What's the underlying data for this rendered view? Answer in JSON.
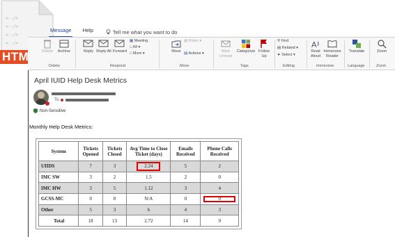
{
  "file_badge": "HTML",
  "ribbon": {
    "tabs": [
      "Message",
      "Help"
    ],
    "active_tab": "Message",
    "tell_me": "Tell me what you want to do",
    "buttons": {
      "delete": "Delete",
      "archive": "Archive",
      "reply": "Reply",
      "reply_all": "Reply All",
      "forward": "Forward",
      "meeting": "Meeting",
      "im": "IM",
      "more": "More",
      "move": "Move",
      "rules": "Rules",
      "actions": "Actions",
      "mark_unread": "Mark Unread",
      "categorize": "Categorize",
      "follow_up": "Follow Up",
      "find": "Find",
      "related": "Related",
      "select": "Select",
      "read_aloud": "Read Aloud",
      "immersive_reader": "Immersive Reader",
      "translate": "Translate",
      "zoom": "Zoom"
    },
    "groups": {
      "delete": "Delete",
      "respond": "Respond",
      "move": "Move",
      "tags": "Tags",
      "editing": "Editing",
      "immersive": "Immersive",
      "language": "Language",
      "zoom": "Zoom"
    }
  },
  "message": {
    "subject": "April IUID Help Desk Metrics",
    "to_label": "To",
    "sensitivity": "Non-Sensitive",
    "intro": "Monthly Help Desk Metrics:"
  },
  "table": {
    "headers": [
      "System",
      "Tickets Opened",
      "Tickets Closed",
      "Avg Time to Close Ticket (days)",
      "Emails Received",
      "Phone Calls Received"
    ],
    "rows": [
      {
        "system": "UIIDS",
        "opened": "7",
        "closed": "3",
        "avg": "2.24",
        "emails": "5",
        "calls": "2",
        "shaded": true
      },
      {
        "system": "IMC SW",
        "opened": "3",
        "closed": "2",
        "avg": "1.5",
        "emails": "2",
        "calls": "0",
        "shaded": false
      },
      {
        "system": "IMC HW",
        "opened": "3",
        "closed": "5",
        "avg": "1.12",
        "emails": "3",
        "calls": "4",
        "shaded": true
      },
      {
        "system": "GCSS-MC",
        "opened": "0",
        "closed": "0",
        "avg": "N/A",
        "emails": "0",
        "calls": "0",
        "shaded": false
      },
      {
        "system": "Other",
        "opened": "5",
        "closed": "3",
        "avg": "6",
        "emails": "4",
        "calls": "3",
        "shaded": true
      }
    ],
    "total": {
      "system": "Total",
      "opened": "18",
      "closed": "13",
      "avg": "2.72",
      "emails": "14",
      "calls": "9"
    }
  },
  "colors": {
    "html_badge": "#e44d26",
    "highlight": "#e00000",
    "shaded_row": "#d9d9d9",
    "accent": "#2b579a"
  }
}
